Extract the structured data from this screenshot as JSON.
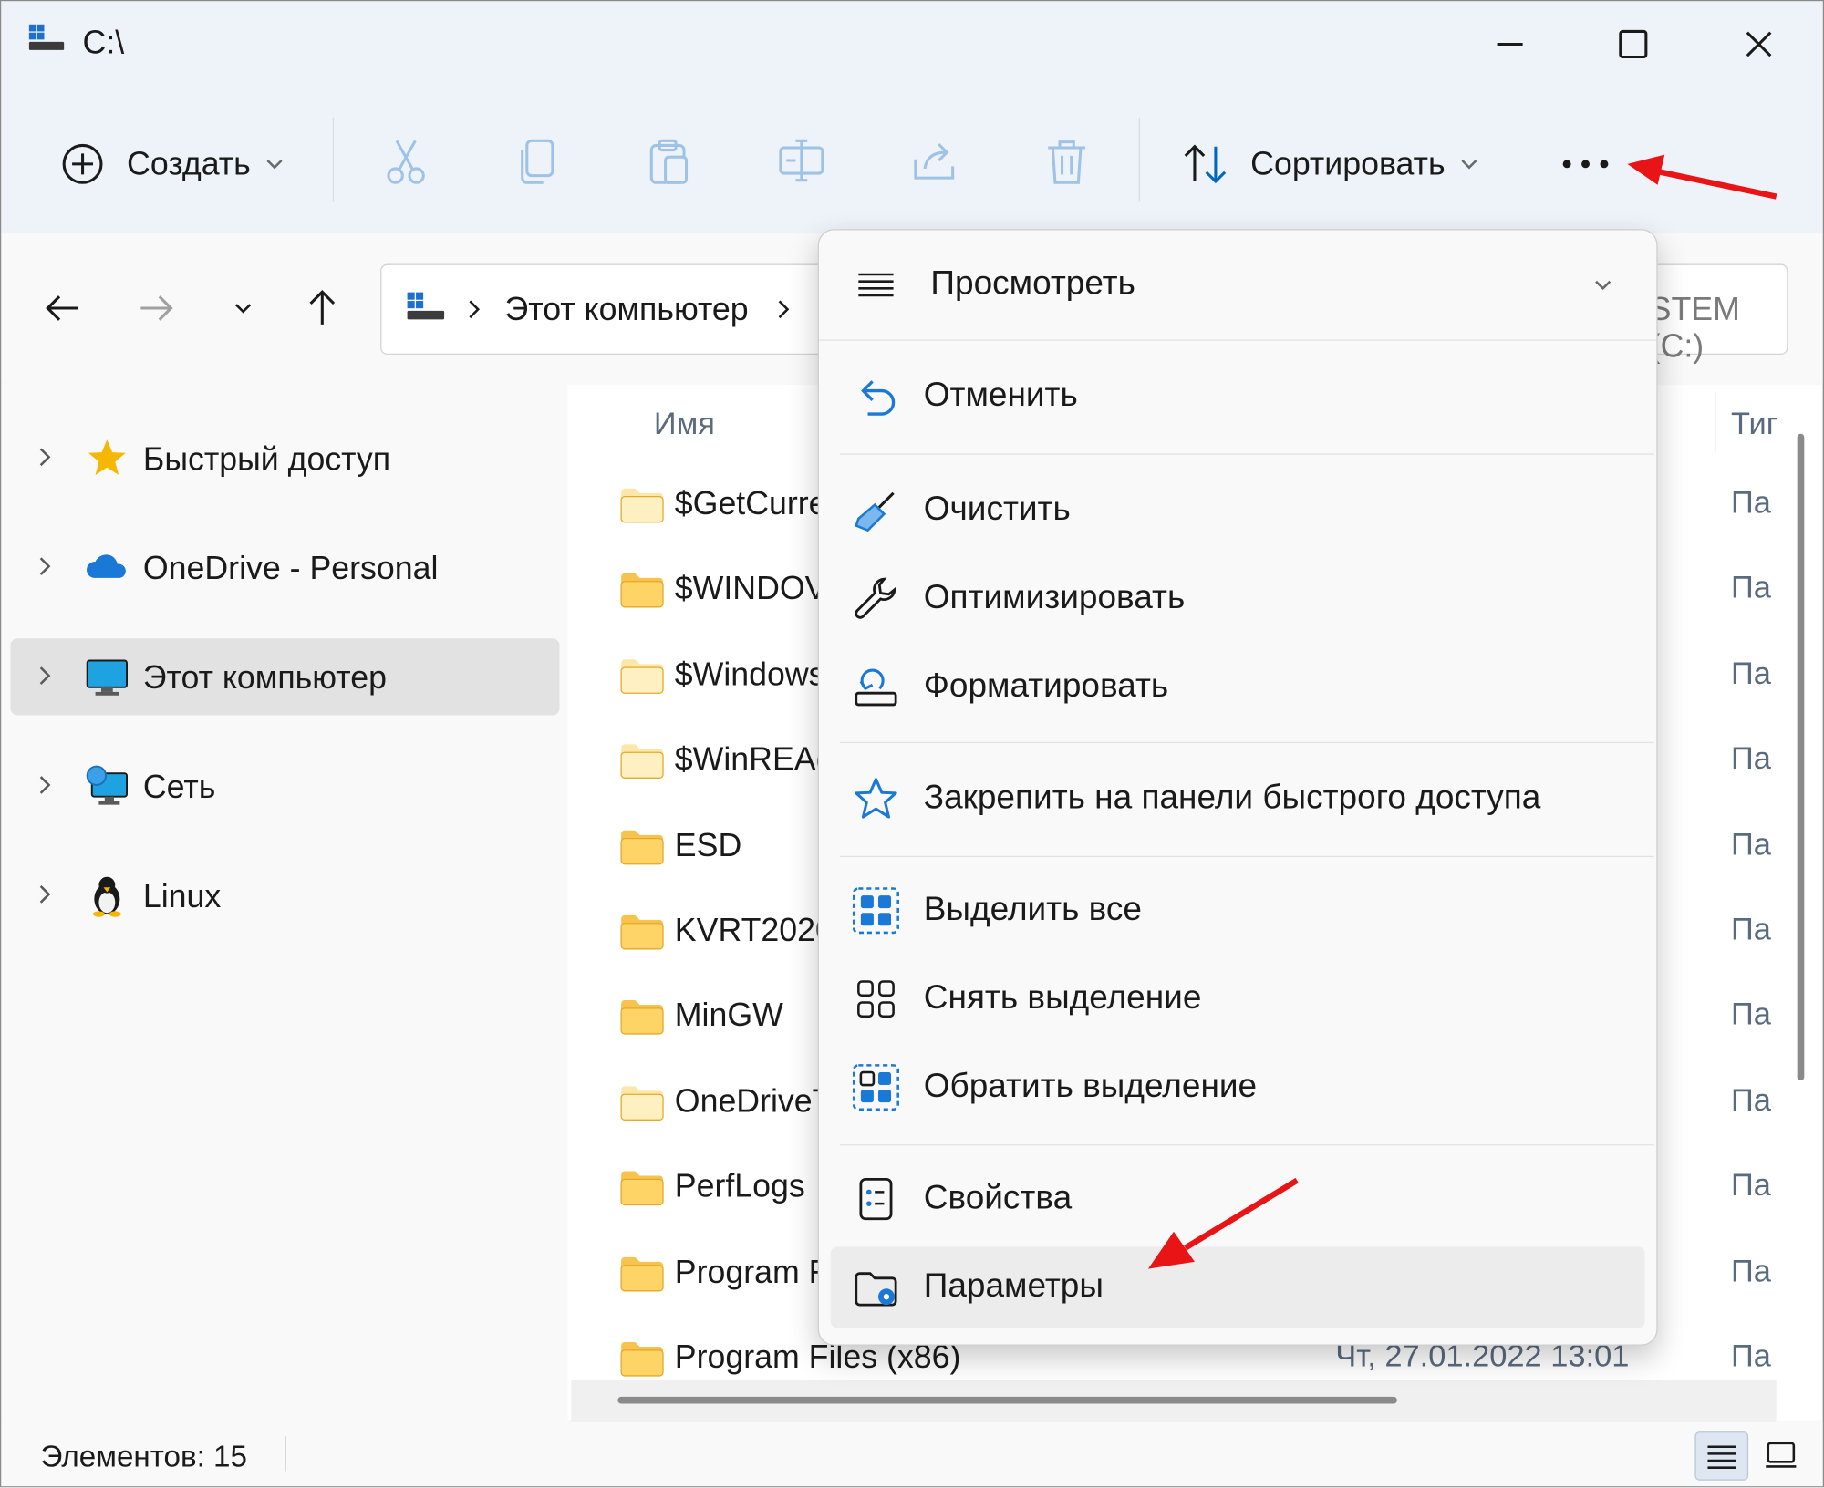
{
  "window": {
    "title": "C:\\",
    "controls": {
      "minimize": "minimize-icon",
      "maximize": "maximize-icon",
      "close": "close-icon"
    }
  },
  "toolbar": {
    "create_label": "Создать",
    "sort_label": "Сортировать",
    "disabled_actions": [
      "cut-icon",
      "copy-icon",
      "paste-icon",
      "rename-icon",
      "share-icon",
      "delete-icon"
    ],
    "more_icon": "more-icon"
  },
  "nav": {
    "breadcrumb_computer": "Этот компьютер",
    "breadcrumb_drive_partial": "STEM (C:)"
  },
  "sidebar": {
    "items": [
      {
        "label": "Быстрый доступ",
        "icon": "star-icon"
      },
      {
        "label": "OneDrive - Personal",
        "icon": "cloud-icon"
      },
      {
        "label": "Этот компьютер",
        "icon": "computer-icon",
        "selected": true
      },
      {
        "label": "Сеть",
        "icon": "network-icon"
      },
      {
        "label": "Linux",
        "icon": "penguin-icon"
      }
    ]
  },
  "content": {
    "column_name": "Имя",
    "column_type_partial": "Тиг",
    "rows": [
      {
        "name": "$GetCurre",
        "date": "",
        "type": "Па",
        "faded": true
      },
      {
        "name": "$WINDOV",
        "date": "",
        "type": "Па",
        "faded": false
      },
      {
        "name": "$Windows",
        "date": "",
        "type": "Па",
        "faded": true
      },
      {
        "name": "$WinREAg",
        "date": "",
        "type": "Па",
        "faded": true
      },
      {
        "name": "ESD",
        "date": "",
        "type": "Па",
        "faded": false
      },
      {
        "name": "KVRT2020_",
        "date": "",
        "type": "Па",
        "faded": false
      },
      {
        "name": "MinGW",
        "date": "",
        "type": "Па",
        "faded": false
      },
      {
        "name": "OneDriveT",
        "date": "",
        "type": "Па",
        "faded": true
      },
      {
        "name": "PerfLogs",
        "date": "",
        "type": "Па",
        "faded": false
      },
      {
        "name": "Program F",
        "date": "",
        "type": "Па",
        "faded": false
      },
      {
        "name": "Program Files (x86)",
        "date": "Чт, 27.01.2022 13:01",
        "type": "Па",
        "faded": false
      }
    ]
  },
  "status": {
    "items_count": "Элементов: 15"
  },
  "menu": {
    "view_label": "Просмотреть",
    "undo_label": "Отменить",
    "cleanup_label": "Очистить",
    "optimize_label": "Оптимизировать",
    "format_label": "Форматировать",
    "pin_label": "Закрепить на панели быстрого доступа",
    "select_all_label": "Выделить все",
    "select_none_label": "Снять выделение",
    "invert_selection_label": "Обратить выделение",
    "properties_label": "Свойства",
    "options_label": "Параметры"
  },
  "colors": {
    "accent": "#0067c0",
    "folder": "#f8c34c",
    "annotation_arrow": "#e81416"
  }
}
